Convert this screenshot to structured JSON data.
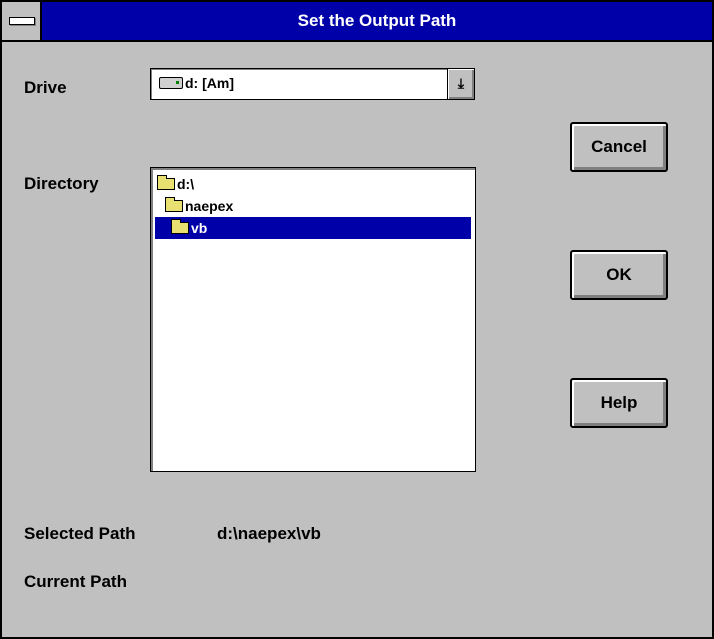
{
  "window": {
    "title": "Set the Output Path"
  },
  "drive": {
    "label": "Drive",
    "selected": "d: [Am]",
    "dropdown_icon": "arrow-down-icon"
  },
  "directory": {
    "label": "Directory",
    "items": [
      {
        "name": "d:\\",
        "icon": "folder-open-icon",
        "selected": false
      },
      {
        "name": "naepex",
        "icon": "folder-open-icon",
        "selected": false
      },
      {
        "name": "vb",
        "icon": "folder-open-icon",
        "selected": true
      }
    ]
  },
  "buttons": {
    "cancel": "Cancel",
    "ok": "OK",
    "help": "Help"
  },
  "paths": {
    "selected_label": "Selected Path",
    "selected_value": "d:\\naepex\\vb",
    "current_label": "Current Path",
    "current_value": ""
  },
  "colors": {
    "titlebar": "#0000a8",
    "face": "#c0c0c0",
    "selection": "#0000a8"
  }
}
